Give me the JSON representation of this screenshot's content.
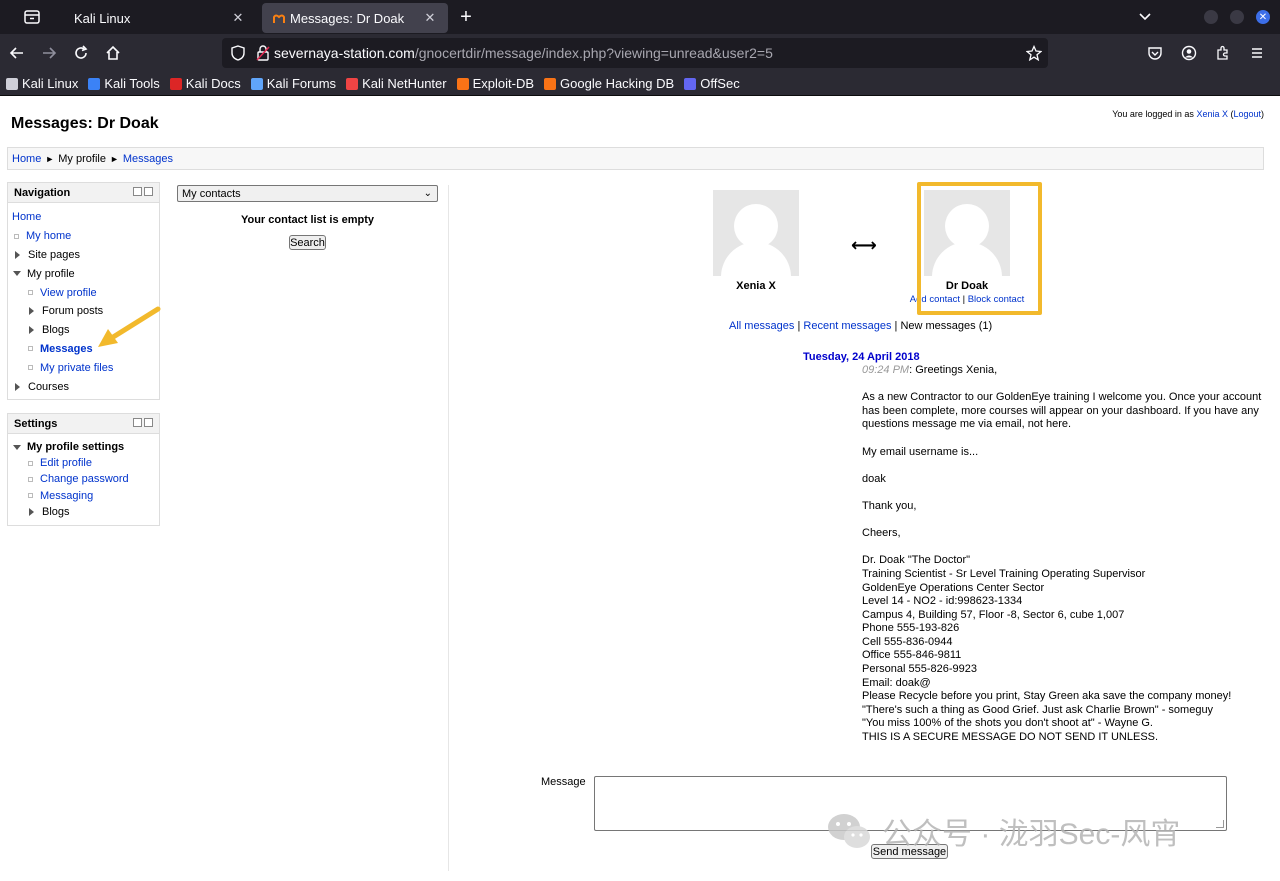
{
  "browser": {
    "tabs": [
      {
        "title": "Kali Linux",
        "active": false
      },
      {
        "title": "Messages: Dr Doak",
        "active": true
      }
    ],
    "url_host": "severnaya-station.com",
    "url_path": "/gnocertdir/message/index.php?viewing=unread&user2=5",
    "bookmarks": [
      {
        "label": "Kali Linux",
        "icon": "kali-dragon-icon",
        "color": "#cfcfd8"
      },
      {
        "label": "Kali Tools",
        "icon": "kali-tools-icon",
        "color": "#3b82f6"
      },
      {
        "label": "Kali Docs",
        "icon": "kali-docs-icon",
        "color": "#dc2626"
      },
      {
        "label": "Kali Forums",
        "icon": "kali-forums-icon",
        "color": "#60a5fa"
      },
      {
        "label": "Kali NetHunter",
        "icon": "nethunter-icon",
        "color": "#ef4444"
      },
      {
        "label": "Exploit-DB",
        "icon": "exploitdb-icon",
        "color": "#f97316"
      },
      {
        "label": "Google Hacking DB",
        "icon": "ghdb-icon",
        "color": "#f97316"
      },
      {
        "label": "OffSec",
        "icon": "offsec-icon",
        "color": "#6366f1"
      }
    ]
  },
  "page": {
    "heading": "Messages: Dr Doak",
    "login": {
      "prefix": "You are logged in as ",
      "user": "Xenia X",
      "logout": "Logout"
    },
    "breadcrumb": [
      "Home",
      "My profile",
      "Messages"
    ]
  },
  "navigation": {
    "title": "Navigation",
    "items": [
      {
        "label": "Home"
      },
      {
        "label": "My home"
      },
      {
        "label": "Site pages"
      },
      {
        "label": "My profile"
      },
      {
        "label": "View profile"
      },
      {
        "label": "Forum posts"
      },
      {
        "label": "Blogs"
      },
      {
        "label": "Messages"
      },
      {
        "label": "My private files"
      },
      {
        "label": "Courses"
      }
    ]
  },
  "settings": {
    "title": "Settings",
    "items": [
      {
        "label": "My profile settings"
      },
      {
        "label": "Edit profile"
      },
      {
        "label": "Change password"
      },
      {
        "label": "Messaging"
      },
      {
        "label": "Blogs"
      }
    ]
  },
  "contacts": {
    "selected": "My contacts",
    "empty_text": "Your contact list is empty",
    "search_label": "Search"
  },
  "conversation": {
    "user_left": "Xenia X",
    "user_right": "Dr Doak",
    "add_contact": "Add contact",
    "block_contact": "Block contact",
    "arrow": "⟷",
    "all_messages": "All messages",
    "recent_messages": "Recent messages",
    "new_messages": "New messages (1)",
    "date": "Tuesday, 24 April 2018",
    "time": "09:24 PM",
    "lines": [
      "Greetings Xenia,",
      "",
      "As a new Contractor to our GoldenEye training I welcome you. Once your account has been complete, more courses will appear on your dashboard. If you have any questions message me via email, not here.",
      "",
      "My email username is...",
      "",
      "doak",
      "",
      "Thank you,",
      "",
      "Cheers,",
      "",
      "Dr. Doak \"The Doctor\"",
      "Training Scientist - Sr Level Training Operating Supervisor",
      "GoldenEye Operations Center Sector",
      "Level 14 - NO2 - id:998623-1334",
      "Campus 4, Building 57, Floor -8, Sector 6, cube 1,007",
      "Phone 555-193-826",
      "Cell 555-836-0944",
      "Office 555-846-9811",
      "Personal 555-826-9923",
      "Email: doak@",
      "Please Recycle before you print, Stay Green aka save the company money!",
      "\"There's such a thing as Good Grief. Just ask Charlie Brown\" - someguy",
      "\"You miss 100% of the shots you don't shoot at\" - Wayne G.",
      "THIS IS A SECURE MESSAGE DO NOT SEND IT UNLESS."
    ]
  },
  "compose": {
    "label": "Message",
    "value": "",
    "send_label": "Send message"
  },
  "watermark": "公众号 · 泷羽Sec-风宵",
  "colors": {
    "highlight": "#f2b92c",
    "link": "#0033cc",
    "date": "#0000cc"
  }
}
